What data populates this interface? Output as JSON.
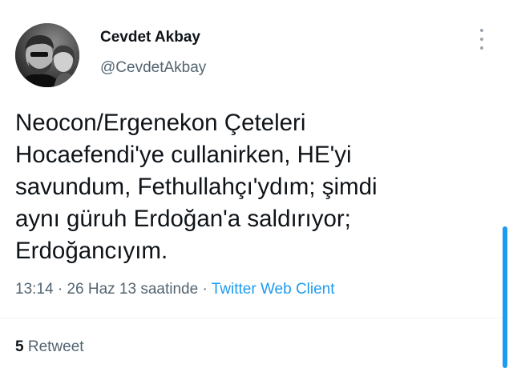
{
  "author": {
    "display_name": "Cevdet Akbay",
    "handle": "@CevdetAkbay"
  },
  "tweet": {
    "text_lines": [
      "Neocon/Ergenekon Çeteleri",
      "Hocaefendi'ye cullanirken, HE'yi",
      "savundum, Fethullahçı'ydım; şimdi",
      "aynı güruh Erdoğan'a saldırıyor;",
      "Erdoğancıyım."
    ],
    "time": "13:14",
    "separator": "·",
    "date": "26 Haz 13 saatinde",
    "source": "Twitter Web Client"
  },
  "stats": {
    "retweet_count": "5",
    "retweet_label": "Retweet"
  },
  "icons": {
    "more": "more-options-icon",
    "avatar": "profile-photo"
  },
  "colors": {
    "link": "#1d9bf0",
    "secondary_text": "#536471",
    "primary_text": "#0f1419"
  }
}
